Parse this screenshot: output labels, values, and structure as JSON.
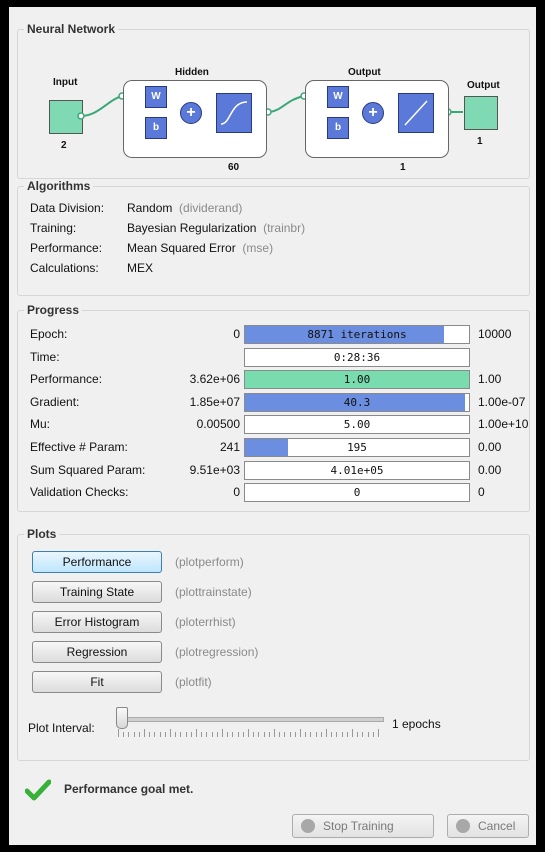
{
  "network": {
    "section_title": "Neural Network",
    "input_label": "Input",
    "input_size": "2",
    "hidden_label": "Hidden",
    "hidden_size": "60",
    "output_layer_label": "Output",
    "output_layer_size": "1",
    "output_label": "Output",
    "output_size": "1",
    "weight_symbol": "W",
    "bias_symbol": "b",
    "sum_symbol": "+"
  },
  "algorithms": {
    "section_title": "Algorithms",
    "rows": [
      {
        "label": "Data Division:",
        "value": "Random",
        "fn": "(dividerand)"
      },
      {
        "label": "Training:",
        "value": "Bayesian Regularization",
        "fn": "(trainbr)"
      },
      {
        "label": "Performance:",
        "value": "Mean Squared Error",
        "fn": "(mse)"
      },
      {
        "label": "Calculations:",
        "value": "MEX",
        "fn": ""
      }
    ]
  },
  "progress": {
    "section_title": "Progress",
    "rows": [
      {
        "label": "Epoch:",
        "start": "0",
        "bar_text": "8871 iterations",
        "end": "10000",
        "fill": 0.887,
        "color": "#6b8ee0"
      },
      {
        "label": "Time:",
        "start": "",
        "bar_text": "0:28:36",
        "end": "",
        "fill": 0,
        "color": "#6b8ee0"
      },
      {
        "label": "Performance:",
        "start": "3.62e+06",
        "bar_text": "1.00",
        "end": "1.00",
        "fill": 1.0,
        "color": "#78dcae"
      },
      {
        "label": "Gradient:",
        "start": "1.85e+07",
        "bar_text": "40.3",
        "end": "1.00e-07",
        "fill": 0.98,
        "color": "#6b8ee0"
      },
      {
        "label": "Mu:",
        "start": "0.00500",
        "bar_text": "5.00",
        "end": "1.00e+10",
        "fill": 0,
        "color": "#6b8ee0"
      },
      {
        "label": "Effective # Param:",
        "start": "241",
        "bar_text": "195",
        "end": "0.00",
        "fill": 0.19,
        "color": "#6b8ee0"
      },
      {
        "label": "Sum Squared Param:",
        "start": "9.51e+03",
        "bar_text": "4.01e+05",
        "end": "0.00",
        "fill": 0,
        "color": "#6b8ee0"
      },
      {
        "label": "Validation Checks:",
        "start": "0",
        "bar_text": "0",
        "end": "0",
        "fill": 0,
        "color": "#6b8ee0"
      }
    ]
  },
  "plots": {
    "section_title": "Plots",
    "buttons": [
      {
        "label": "Performance",
        "fn": "(plotperform)"
      },
      {
        "label": "Training State",
        "fn": "(plottrainstate)"
      },
      {
        "label": "Error Histogram",
        "fn": "(ploterrhist)"
      },
      {
        "label": "Regression",
        "fn": "(plotregression)"
      },
      {
        "label": "Fit",
        "fn": "(plotfit)"
      }
    ],
    "interval_label": "Plot Interval:",
    "interval_value": "1 epochs",
    "slider_position": 0
  },
  "status": {
    "message": "Performance goal met.",
    "icon": "check-icon"
  },
  "footer": {
    "stop_label": "Stop Training",
    "cancel_label": "Cancel"
  }
}
